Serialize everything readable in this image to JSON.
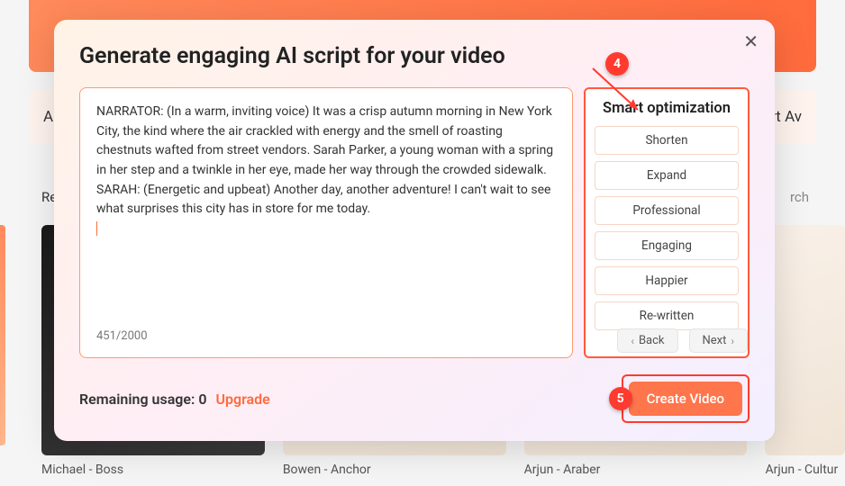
{
  "background": {
    "tabs": [
      "Al",
      "Export Av"
    ],
    "section_label": "Re",
    "search_label": "rch",
    "cards": [
      {
        "label": "Michael - Boss"
      },
      {
        "label": "Bowen - Anchor"
      },
      {
        "label": "Arjun - Araber"
      },
      {
        "label": "Arjun - Cultur"
      }
    ]
  },
  "modal": {
    "title": "Generate engaging AI script for your video",
    "script_text": "NARRATOR: (In a warm, inviting voice) It was a crisp autumn morning in New York City, the kind where the air crackled with energy and the smell of roasting chestnuts wafted from street vendors. Sarah Parker, a young woman with a spring in her step and a twinkle in her eye, made her way through the crowded sidewalk.\nSARAH: (Energetic and upbeat) Another day, another adventure! I can't wait to see what surprises this city has in store for me today.",
    "char_count": "451/2000",
    "optimization": {
      "title": "Smart optimization",
      "options": [
        "Shorten",
        "Expand",
        "Professional",
        "Engaging",
        "Happier",
        "Re-written"
      ]
    },
    "nav": {
      "back": "Back",
      "next": "Next"
    },
    "footer": {
      "usage_label": "Remaining usage: ",
      "usage_value": "0",
      "upgrade": "Upgrade",
      "create_video": "Create Video"
    },
    "markers": {
      "m4": "4",
      "m5": "5"
    }
  }
}
